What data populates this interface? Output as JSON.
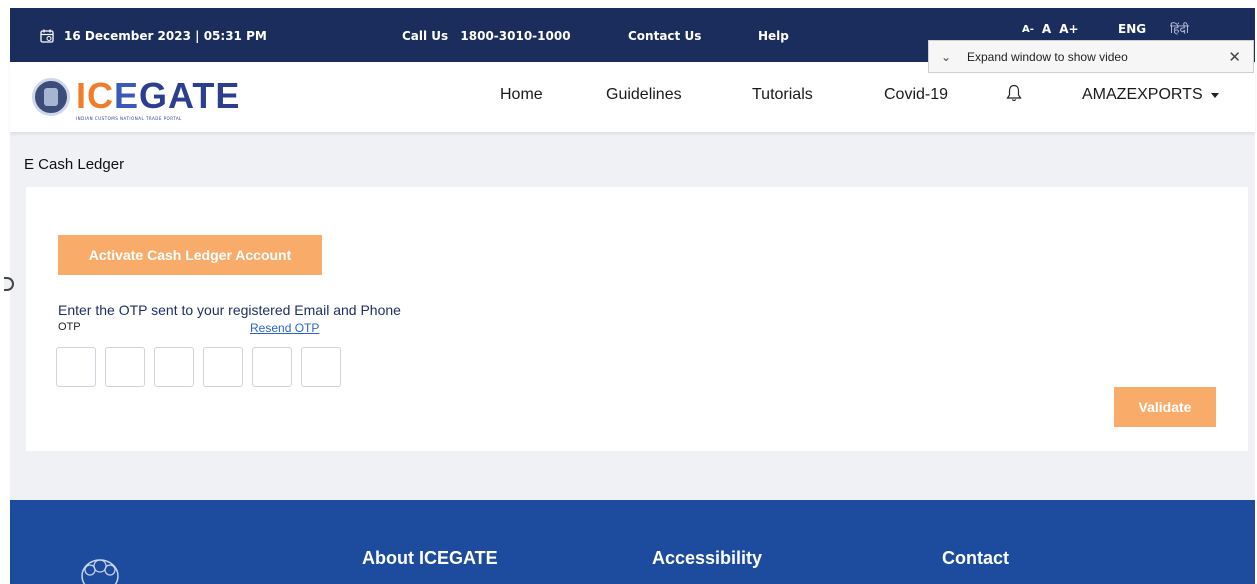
{
  "topbar": {
    "datetime": "16 December 2023 | 05:31 PM",
    "call_label": "Call Us",
    "call_number": "1800-3010-1000",
    "contact": "Contact Us",
    "help": "Help",
    "font_small": "A-",
    "font_normal": "A",
    "font_large": "A+",
    "lang_english": "ENG",
    "lang_hindi": "हिंदी"
  },
  "video_popup": {
    "text": "Expand window to show video",
    "close": "✕"
  },
  "logo": {
    "word_ic": "IC",
    "word_e": "E",
    "word_ate": "GATE",
    "subtitle": "INDIAN CUSTOMS NATIONAL TRADE PORTAL"
  },
  "nav": {
    "items": [
      "Home",
      "Guidelines",
      "Tutorials",
      "Covid-19"
    ],
    "user": "AMAZEXPORTS"
  },
  "page": {
    "title": "E Cash Ledger",
    "activate_button": "Activate Cash Ledger Account",
    "otp_instruction": "Enter the OTP sent to your registered Email and Phone",
    "otp_label": "OTP",
    "resend_link": "Resend OTP",
    "validate_button": "Validate"
  },
  "footer": {
    "columns": [
      "About ICEGATE",
      "Accessibility",
      "Contact"
    ]
  },
  "colors": {
    "topbar_bg": "#1b2d5c",
    "accent_orange": "#f9ac6a",
    "footer_bg": "#1d4b9e",
    "link_blue": "#2a63c6"
  }
}
